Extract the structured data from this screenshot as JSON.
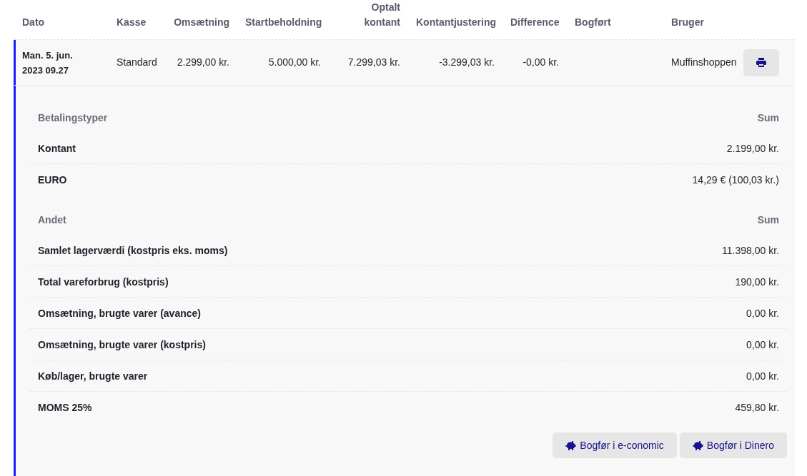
{
  "table": {
    "columns": [
      {
        "label": "Dato",
        "kind": "text"
      },
      {
        "label": "Kasse",
        "kind": "text"
      },
      {
        "label": "Omsætning",
        "kind": "amount"
      },
      {
        "label": "Startbeholdning",
        "kind": "amount"
      },
      {
        "label": "Optalt kontant",
        "kind": "amount"
      },
      {
        "label": "Kontantjustering",
        "kind": "amount"
      },
      {
        "label": "Difference",
        "kind": "amount"
      },
      {
        "label": "Bogført",
        "kind": "text"
      },
      {
        "label": "Bruger",
        "kind": "text"
      }
    ],
    "rows": [
      {
        "expanded": true,
        "cells": [
          "Man. 5. jun. 2023 09.27",
          "Standard",
          "2.299,00 kr.",
          "5.000,00 kr.",
          "7.299,03 kr.",
          "-3.299,03 kr.",
          "-0,00 kr.",
          "",
          "Muffinshoppen"
        ],
        "details": {
          "sections": [
            {
              "heading": "Betalingstyper",
              "sum_heading": "Sum",
              "items": [
                {
                  "label": "Kontant",
                  "value": "2.199,00 kr."
                },
                {
                  "label": "EURO",
                  "value": "14,29 € (100,03 kr.)"
                }
              ]
            },
            {
              "heading": "Andet",
              "sum_heading": "Sum",
              "items": [
                {
                  "label": "Samlet lagerværdi (kostpris eks. moms)",
                  "value": "11.398,00 kr."
                },
                {
                  "label": "Total vareforbrug (kostpris)",
                  "value": "190,00 kr."
                },
                {
                  "label": "Omsætning, brugte varer (avance)",
                  "value": "0,00 kr."
                },
                {
                  "label": "Omsætning, brugte varer (kostpris)",
                  "value": "0,00 kr."
                },
                {
                  "label": "Køb/lager, brugte varer",
                  "value": "0,00 kr."
                },
                {
                  "label": "MOMS 25%",
                  "value": "459,80 kr."
                }
              ]
            }
          ],
          "buttons": [
            {
              "label": "Bogfør i e-conomic"
            },
            {
              "label": "Bogfør i Dinero"
            }
          ]
        }
      }
    ]
  }
}
